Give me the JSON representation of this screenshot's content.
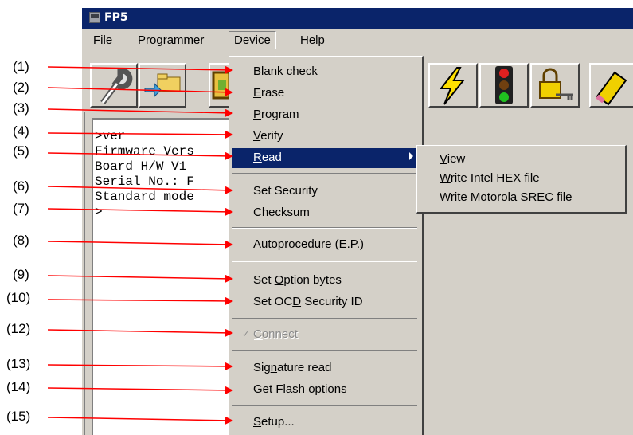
{
  "window": {
    "title": "FP5"
  },
  "menubar": [
    "File",
    "Programmer",
    "Device",
    "Help"
  ],
  "log_lines": [
    ">ver",
    "Firmware Vers",
    "Board H/W V1",
    "Serial No.: F",
    "Standard mode",
    ">"
  ],
  "device_menu": {
    "items": [
      "Blank check",
      "Erase",
      "Program",
      "Verify",
      "Read",
      "Set Security",
      "Checksum",
      "Autoprocedure (E.P.)",
      "Set Option bytes",
      "Set OCD Security ID",
      "Connect",
      "Signature read",
      "Get Flash options",
      "Setup..."
    ],
    "disabled": [
      "Connect"
    ],
    "highlighted": "Read",
    "checked": "Connect"
  },
  "read_submenu": [
    "View",
    "Write Intel HEX file",
    "Write Motorola SREC file"
  ],
  "callouts": [
    "(1)",
    "(2)",
    "(3)",
    "(4)",
    "(5)",
    "(6)",
    "(7)",
    "(8)",
    "(9)",
    "(10)",
    "(12)",
    "(13)",
    "(14)",
    "(15)"
  ],
  "colors": {
    "titlebar": "#0a246a",
    "arrow": "#ff0000",
    "menu_bg": "#d4d0c8",
    "highlight": "#0a246a"
  },
  "icons": [
    "wrench-icon",
    "folder-transfer-icon",
    "chip-icon",
    "lightning-icon",
    "traffic-light-icon",
    "padlock-key-icon",
    "eraser-pencil-icon"
  ]
}
